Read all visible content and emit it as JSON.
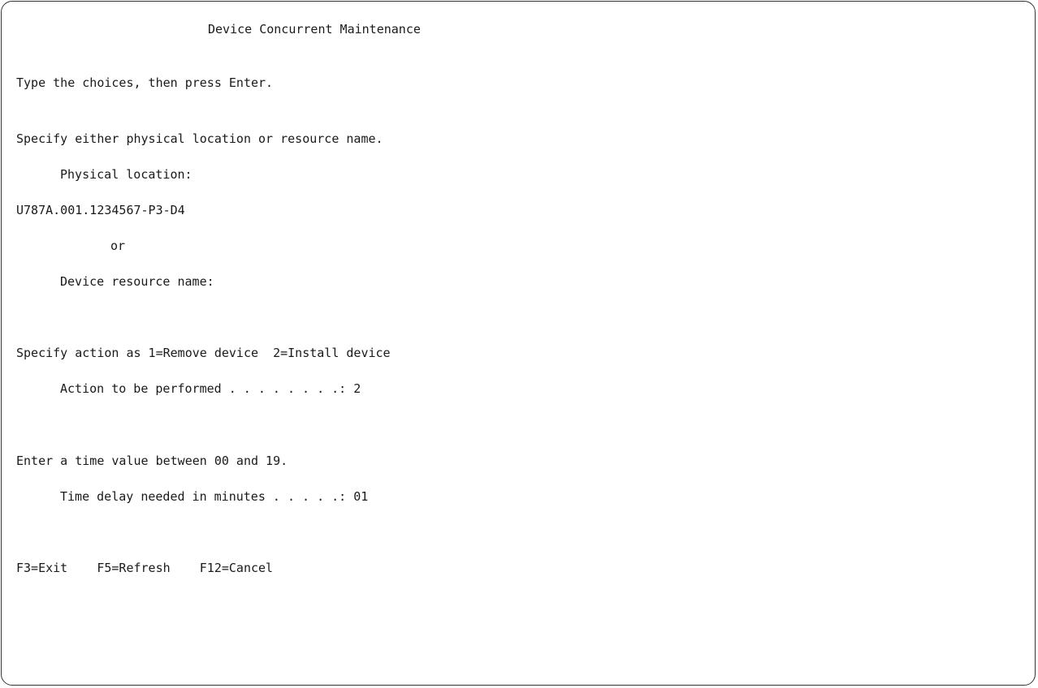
{
  "screen": {
    "title": "Device Concurrent Maintenance",
    "instruction": "Type the choices, then press Enter.",
    "location_prompt": "Specify either physical location or resource name.",
    "physical_location_label": "Physical location:",
    "physical_location_value": "U787A.001.1234567-P3-D4",
    "or_label": "or",
    "resource_name_label": "Device resource name:",
    "resource_name_value": "",
    "action_prompt": "Specify action as 1=Remove device  2=Install device",
    "action_label": "Action to be performed . . . . . . . .: ",
    "action_value": "2",
    "time_prompt": "Enter a time value between 00 and 19.",
    "time_label": "Time delay needed in minutes . . . . .: ",
    "time_value": "01"
  },
  "function_keys": {
    "exit": "F3=Exit",
    "refresh": "F5=Refresh",
    "cancel": "F12=Cancel"
  }
}
